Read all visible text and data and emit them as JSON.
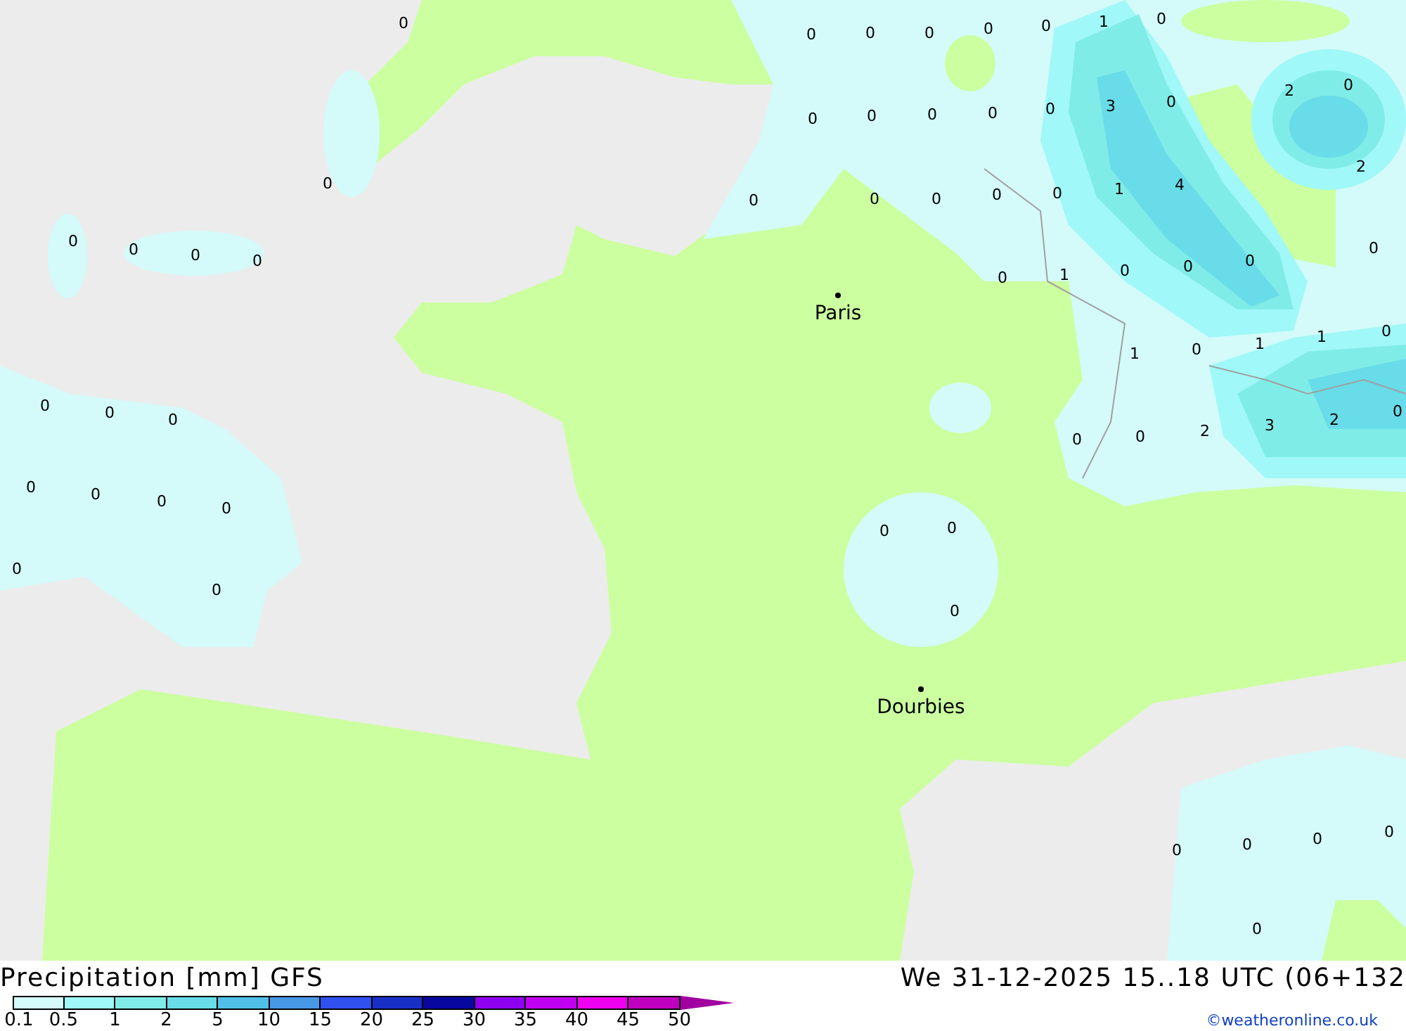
{
  "map": {
    "cities": [
      {
        "name": "Paris"
      },
      {
        "name": "Dourbies"
      }
    ],
    "values": [
      "0",
      "0",
      "0",
      "0",
      "0",
      "0",
      "1",
      "0",
      "0",
      "0",
      "0",
      "0",
      "0",
      "3",
      "0",
      "2",
      "0",
      "0",
      "0",
      "0",
      "0",
      "0",
      "0",
      "1",
      "4",
      "2",
      "0",
      "0",
      "0",
      "0",
      "0",
      "1",
      "0",
      "0",
      "0",
      "0",
      "1",
      "0",
      "1",
      "1",
      "0",
      "0",
      "0",
      "0",
      "0",
      "0",
      "2",
      "3",
      "2",
      "0",
      "0",
      "0",
      "0",
      "0",
      "0",
      "0",
      "0",
      "0",
      "0",
      "0",
      "0",
      "0",
      "0",
      "0"
    ]
  },
  "footer": {
    "title": "Precipitation [mm] GFS",
    "valid_time": "We 31-12-2025 15..18 UTC (06+132",
    "credit": "©weatheronline.co.uk"
  },
  "legend": [
    {
      "label": "0.1",
      "color": "#d4fafa"
    },
    {
      "label": "0.5",
      "color": "#a0f8f8"
    },
    {
      "label": "1",
      "color": "#80ece8"
    },
    {
      "label": "2",
      "color": "#68dce8"
    },
    {
      "label": "5",
      "color": "#50c0e8"
    },
    {
      "label": "10",
      "color": "#4898e8"
    },
    {
      "label": "15",
      "color": "#3050f0"
    },
    {
      "label": "20",
      "color": "#1830c8"
    },
    {
      "label": "25",
      "color": "#0808a0"
    },
    {
      "label": "30",
      "color": "#9000f0"
    },
    {
      "label": "35",
      "color": "#c000f0"
    },
    {
      "label": "40",
      "color": "#f000f0"
    },
    {
      "label": "45",
      "color": "#c000c0"
    },
    {
      "label": "50",
      "color": "#a000a0"
    }
  ]
}
